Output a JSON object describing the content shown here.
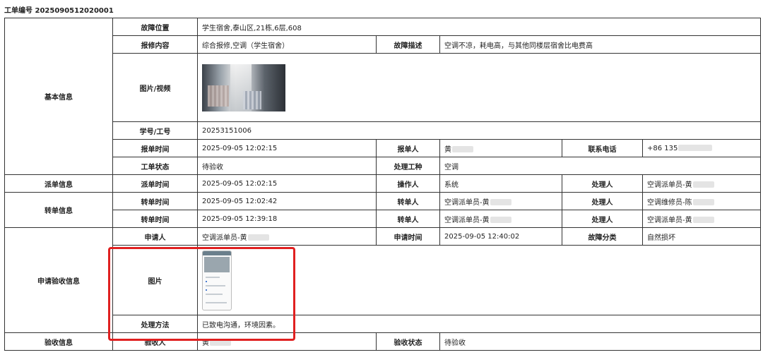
{
  "order_number": "工单编号 2025090512020001",
  "basic": {
    "section": "基本信息",
    "location_label": "故障位置",
    "location_value": "学生宿舍,泰山区,21栋,6层,608",
    "content_label": "报修内容",
    "content_value": "综合报修,空调（学生宿舍）",
    "desc_label": "故障描述",
    "desc_value": "空调不凉，耗电高，与其他同楼层宿舍比电费高",
    "media_label": "图片/视频",
    "id_label": "学号/工号",
    "id_value": "20253151006",
    "report_time_label": "报单时间",
    "report_time_value": "2025-09-05 12:02:15",
    "reporter_label": "报单人",
    "reporter_value": "黄",
    "phone_label": "联系电话",
    "phone_value": "+86 135",
    "status_label": "工单状态",
    "status_value": "待验收",
    "trade_label": "处理工种",
    "trade_value": "空调"
  },
  "dispatch": {
    "section": "派单信息",
    "time_label": "派单时间",
    "time_value": "2025-09-05 12:02:15",
    "operator_label": "操作人",
    "operator_value": "系统",
    "handler_label": "处理人",
    "handler_value": "空调派单员-黄"
  },
  "transfer": {
    "section": "转单信息",
    "rows": [
      {
        "time_label": "转单时间",
        "time_value": "2025-09-05 12:02:42",
        "from_label": "转单人",
        "from_value": "空调派单员-黄",
        "handler_label": "处理人",
        "handler_value": "空调维修员-陈"
      },
      {
        "time_label": "转单时间",
        "time_value": "2025-09-05 12:39:18",
        "from_label": "转单人",
        "from_value": "空调派单员-黄",
        "handler_label": "处理人",
        "handler_value": "空调派单员-黄"
      }
    ]
  },
  "apply": {
    "section": "申请验收信息",
    "applicant_label": "申请人",
    "applicant_value": "空调派单员-黄",
    "apply_time_label": "申请时间",
    "apply_time_value": "2025-09-05 12:40:02",
    "category_label": "故障分类",
    "category_value": "自然损坏",
    "image_label": "图片",
    "method_label": "处理方法",
    "method_value": "已致电沟通，环境因素。"
  },
  "accept": {
    "section": "验收信息",
    "acceptor_label": "验收人",
    "acceptor_value": "黄",
    "status_label": "验收状态",
    "status_value": "待验收"
  }
}
